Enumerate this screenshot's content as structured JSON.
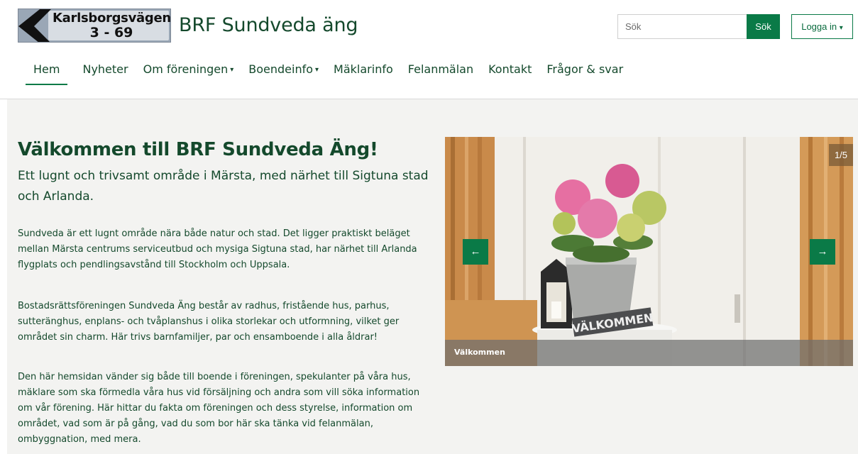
{
  "logo": {
    "line1": "Karlsborgsvägen",
    "line2": "3 - 69"
  },
  "site": {
    "title": "BRF Sundveda äng"
  },
  "search": {
    "placeholder": "Sök",
    "button_label": "Sök"
  },
  "login": {
    "label": "Logga in",
    "caret": "▾"
  },
  "nav": {
    "items": [
      {
        "label": "Hem",
        "active": true
      },
      {
        "label": "Nyheter"
      },
      {
        "label": "Om föreningen",
        "dropdown": true
      },
      {
        "label": "Boendeinfo",
        "dropdown": true
      },
      {
        "label": "Mäklarinfo"
      },
      {
        "label": "Felanmälan"
      },
      {
        "label": "Kontakt"
      },
      {
        "label": "Frågor & svar"
      }
    ],
    "caret": "▾"
  },
  "main": {
    "title": "Välkommen till BRF Sundveda Äng!",
    "subtitle": "Ett lugnt och trivsamt område i Märsta, med närhet till Sigtuna stad och Arlanda.",
    "paragraphs": [
      "Sundveda är ett lugnt område nära både natur och stad. Det ligger praktiskt beläget mellan Märsta centrums serviceutbud och mysiga Sigtuna stad, har närhet till Arlanda flygplats och pendlingsavstånd till Stockholm och Uppsala.",
      "Bostadsrättsföreningen Sundveda Äng består av radhus, fristående hus, parhus, sutteränghus, enplans- och tvåplanshus i olika storlekar och utformning, vilket ger området sin charm. Här trivs barnfamiljer, par och ensamboende i alla åldrar!",
      "Den här hemsidan vänder sig både till boende i föreningen, spekulanter på våra hus, mäklare som ska förmedla våra hus vid försäljning och andra som vill söka information om vår förening. Här hittar du fakta om föreningen och dess styrelse, information om området, vad som är på gång, vad du som bor här ska tänka vid felanmälan, ombyggnation, med mera."
    ]
  },
  "carousel": {
    "counter": "1/5",
    "caption": "Välkommen",
    "sign_text": "VÄLKOMMEN",
    "prev_icon": "arrow-left-icon",
    "next_icon": "arrow-right-icon",
    "prev_glyph": "←",
    "next_glyph": "→"
  },
  "colors": {
    "brand_green": "#0a7a47",
    "text_green": "#14492c",
    "content_bg": "#f3f3f1"
  }
}
